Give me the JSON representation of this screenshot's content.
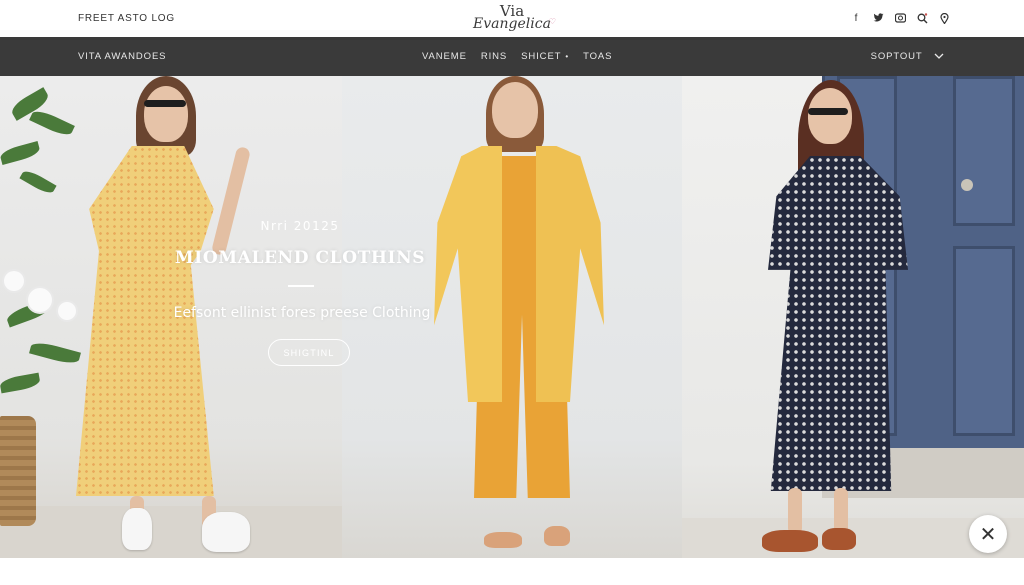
{
  "topbar": {
    "left_text": "FREET ASTO LOG",
    "logo_line1": "Via",
    "logo_line2": "Evangelica",
    "logo_mark": "♡",
    "social_icons": [
      "facebook-icon",
      "twitter-icon",
      "instagram-icon",
      "search-icon",
      "location-icon"
    ],
    "social_glyphs": [
      "f",
      "t",
      "▣",
      "⚲",
      "♢"
    ]
  },
  "navbar": {
    "brand": "VITA AWANDOES",
    "menu": [
      {
        "label": "VANEME",
        "caret": "•"
      },
      {
        "label": "RINS",
        "caret": ""
      },
      {
        "label": "SHICET",
        "caret": "•"
      },
      {
        "label": "TOAS",
        "caret": ""
      }
    ],
    "right_label": "SOPTOUT",
    "right_caret": "⌄"
  },
  "hero": {
    "small_text": "Nrri 20125",
    "title": "MIOMALEND CLOTHINS",
    "subtitle": "Eefsont ellinist fores preese Clothing",
    "button_label": "SHIGTINL"
  },
  "close_glyph": "✕",
  "colors": {
    "nav_bg": "#3a3a3a",
    "door": "#4f6286",
    "yellow_dress": "#f0cf7a",
    "yellow_coat": "#f2c75a",
    "orange_pants": "#e9a336",
    "navy_dress": "#24293d"
  }
}
